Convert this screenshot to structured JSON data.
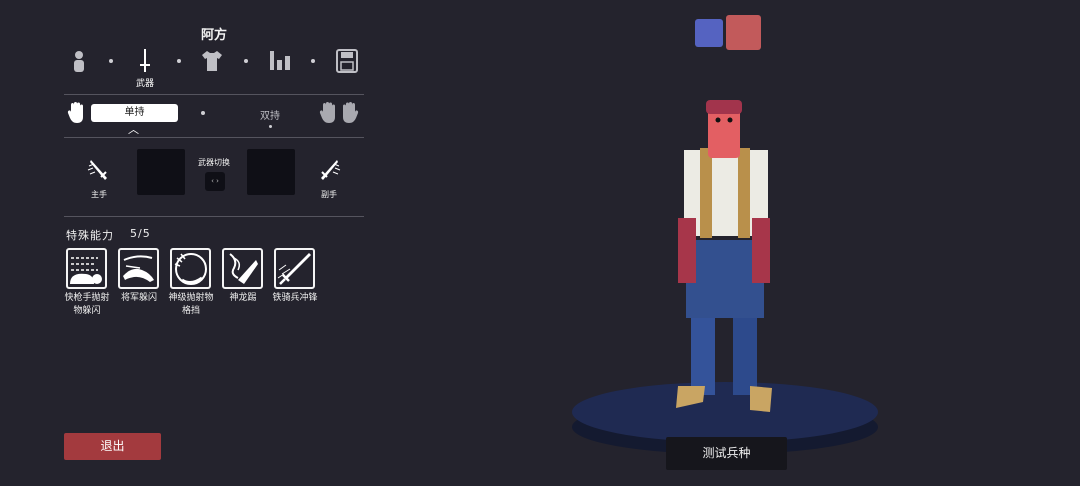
{
  "unit_name": "阿方",
  "tabs": [
    {
      "name": "unit",
      "label": ""
    },
    {
      "name": "weapon",
      "label": "武器"
    },
    {
      "name": "clothing",
      "label": ""
    },
    {
      "name": "stats",
      "label": ""
    },
    {
      "name": "save",
      "label": ""
    }
  ],
  "grip": {
    "single_label": "单持",
    "dual_label": "双持"
  },
  "hands": {
    "main_label": "主手",
    "off_label": "副手",
    "switch_label": "武器切换",
    "switch_keys": "‹ ›"
  },
  "abilities": {
    "heading": "特殊能力",
    "count": "5/5",
    "items": [
      {
        "name": "快枪手抛射物躲闪",
        "line1": "快枪手抛射",
        "line2": "物躲闪",
        "icon": "gunslinger-dodge-icon"
      },
      {
        "name": "将军躲闪",
        "line1": "将军躲闪",
        "line2": "",
        "icon": "general-dodge-icon"
      },
      {
        "name": "神级抛射物格挡",
        "line1": "神级抛射物",
        "line2": "格挡",
        "icon": "god-block-icon"
      },
      {
        "name": "神龙踢",
        "line1": "神龙踢",
        "line2": "",
        "icon": "dragon-kick-icon"
      },
      {
        "name": "铁骑兵冲锋",
        "line1": "铁骑兵冲锋",
        "line2": "",
        "icon": "knight-charge-icon"
      }
    ]
  },
  "exit_label": "退出",
  "team_colors": {
    "blue": "#5563c1",
    "red": "#c25a5b"
  },
  "test_unit_label": "测试兵种"
}
